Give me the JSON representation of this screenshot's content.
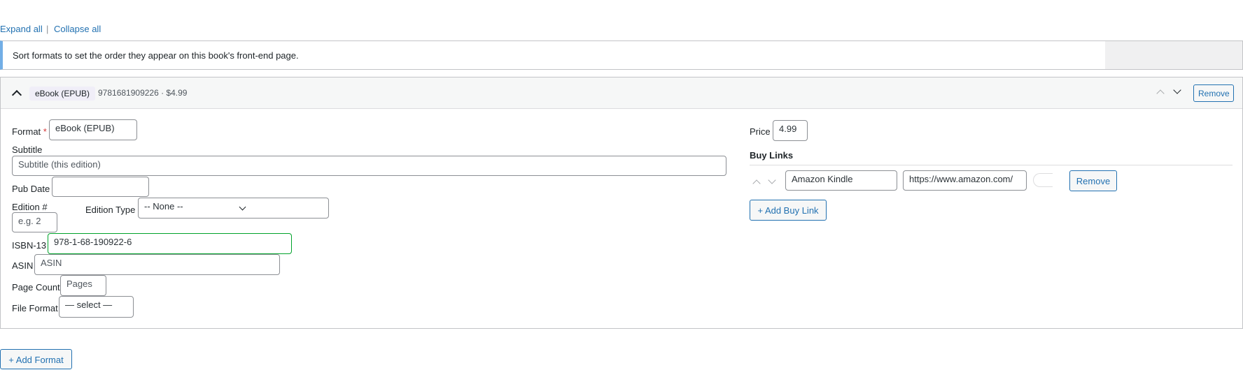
{
  "toolbar": {
    "expand_all": "Expand all",
    "separator": "|",
    "collapse_all": "Collapse all"
  },
  "notice": {
    "text": "Sort formats to set the order they appear on this book's front-end page."
  },
  "format_panel": {
    "badge": "eBook (EPUB)",
    "meta": "9781681909226 · $4.99",
    "remove_label": "Remove",
    "fields": {
      "format_label": "Format",
      "format_required": "*",
      "format_value": "eBook (EPUB)",
      "subtitle_label": "Subtitle",
      "subtitle_placeholder": "Subtitle (this edition)",
      "pub_date_label": "Pub Date",
      "pub_date_value": "",
      "edition_num_label": "Edition #",
      "edition_num_placeholder": "e.g. 2",
      "edition_type_label": "Edition Type",
      "edition_type_value": "-- None --",
      "isbn_label": "ISBN-13",
      "isbn_value": "978-1-68-190922-6",
      "asin_label": "ASIN",
      "asin_placeholder": "ASIN",
      "page_count_label": "Page Count",
      "page_count_placeholder": "Pages",
      "file_format_label": "File Format",
      "file_format_value": "— select —",
      "price_label": "Price",
      "price_value": "4.99"
    },
    "buy_links": {
      "heading": "Buy Links",
      "items": [
        {
          "name": "Amazon Kindle",
          "url": "https://www.amazon.com/"
        }
      ],
      "remove_label": "Remove",
      "add_label": "+ Add Buy Link"
    }
  },
  "add_format_label": "+ Add Format",
  "colors": {
    "link": "#2271b1",
    "notice_accent": "#72aee6",
    "valid_border": "#00a32a",
    "badge_bg": "#f0eef8"
  }
}
